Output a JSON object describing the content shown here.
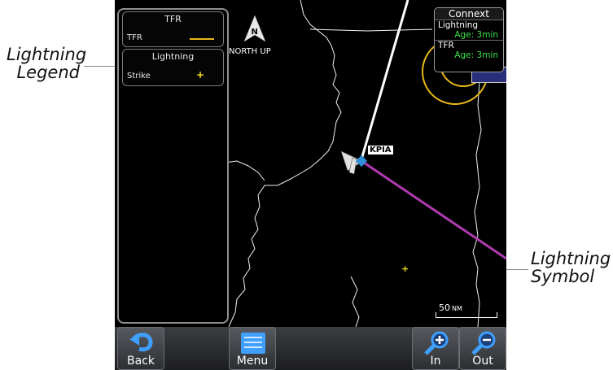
{
  "callouts": {
    "legend_line1": "Lightning",
    "legend_line2": "Legend",
    "symbol_line1": "Lightning",
    "symbol_line2": "Symbol"
  },
  "legend": {
    "tfr_title": "TFR",
    "tfr_row": "TFR",
    "lightning_title": "Lightning",
    "strike_row": "Strike",
    "strike_symbol": "+"
  },
  "map": {
    "north_letter": "N",
    "north_label": "NORTH UP",
    "airport": "KPIA",
    "scale_value": "50",
    "scale_unit": "NM"
  },
  "connext": {
    "title": "Connext",
    "lightning_label": "Lightning",
    "lightning_age": "Age: 3min",
    "tfr_label": "TFR",
    "tfr_age": "Age: 3min"
  },
  "toolbar": {
    "back": "Back",
    "menu": "Menu",
    "zoom_in": "In",
    "zoom_out": "Out"
  },
  "colors": {
    "tfr": "#e8b81a",
    "lightning": "#f5e41a",
    "route": "#b03bb0",
    "age_text": "#3de24a",
    "aircraft": "#2e8fd8"
  }
}
